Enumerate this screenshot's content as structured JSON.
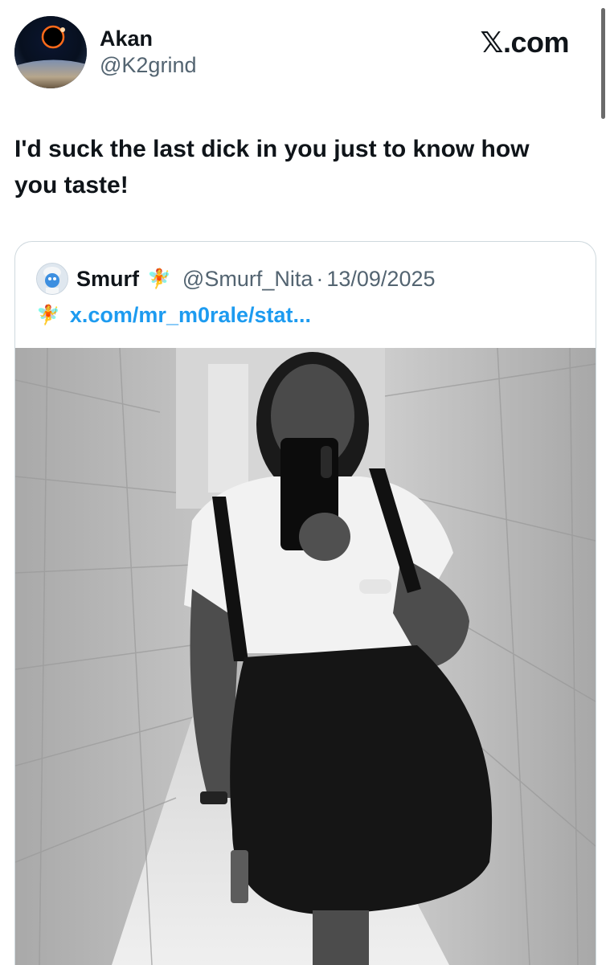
{
  "tweet": {
    "author": {
      "display_name": "Akan",
      "handle": "@K2grind"
    },
    "brand": "𝕏.com",
    "text": "I'd suck the last dick in you just to know how you taste!"
  },
  "quote": {
    "author": {
      "display_name": "Smurf",
      "name_emoji": "🧚",
      "handle": "@Smurf_Nita",
      "separator": "·",
      "date": "13/09/2025"
    },
    "link_emoji": "🧚",
    "link_text": "x.com/mr_m0rale/stat..."
  },
  "colors": {
    "text_primary": "#0f1419",
    "text_secondary": "#536471",
    "link": "#1d9bf0",
    "border": "#cfd9de"
  }
}
